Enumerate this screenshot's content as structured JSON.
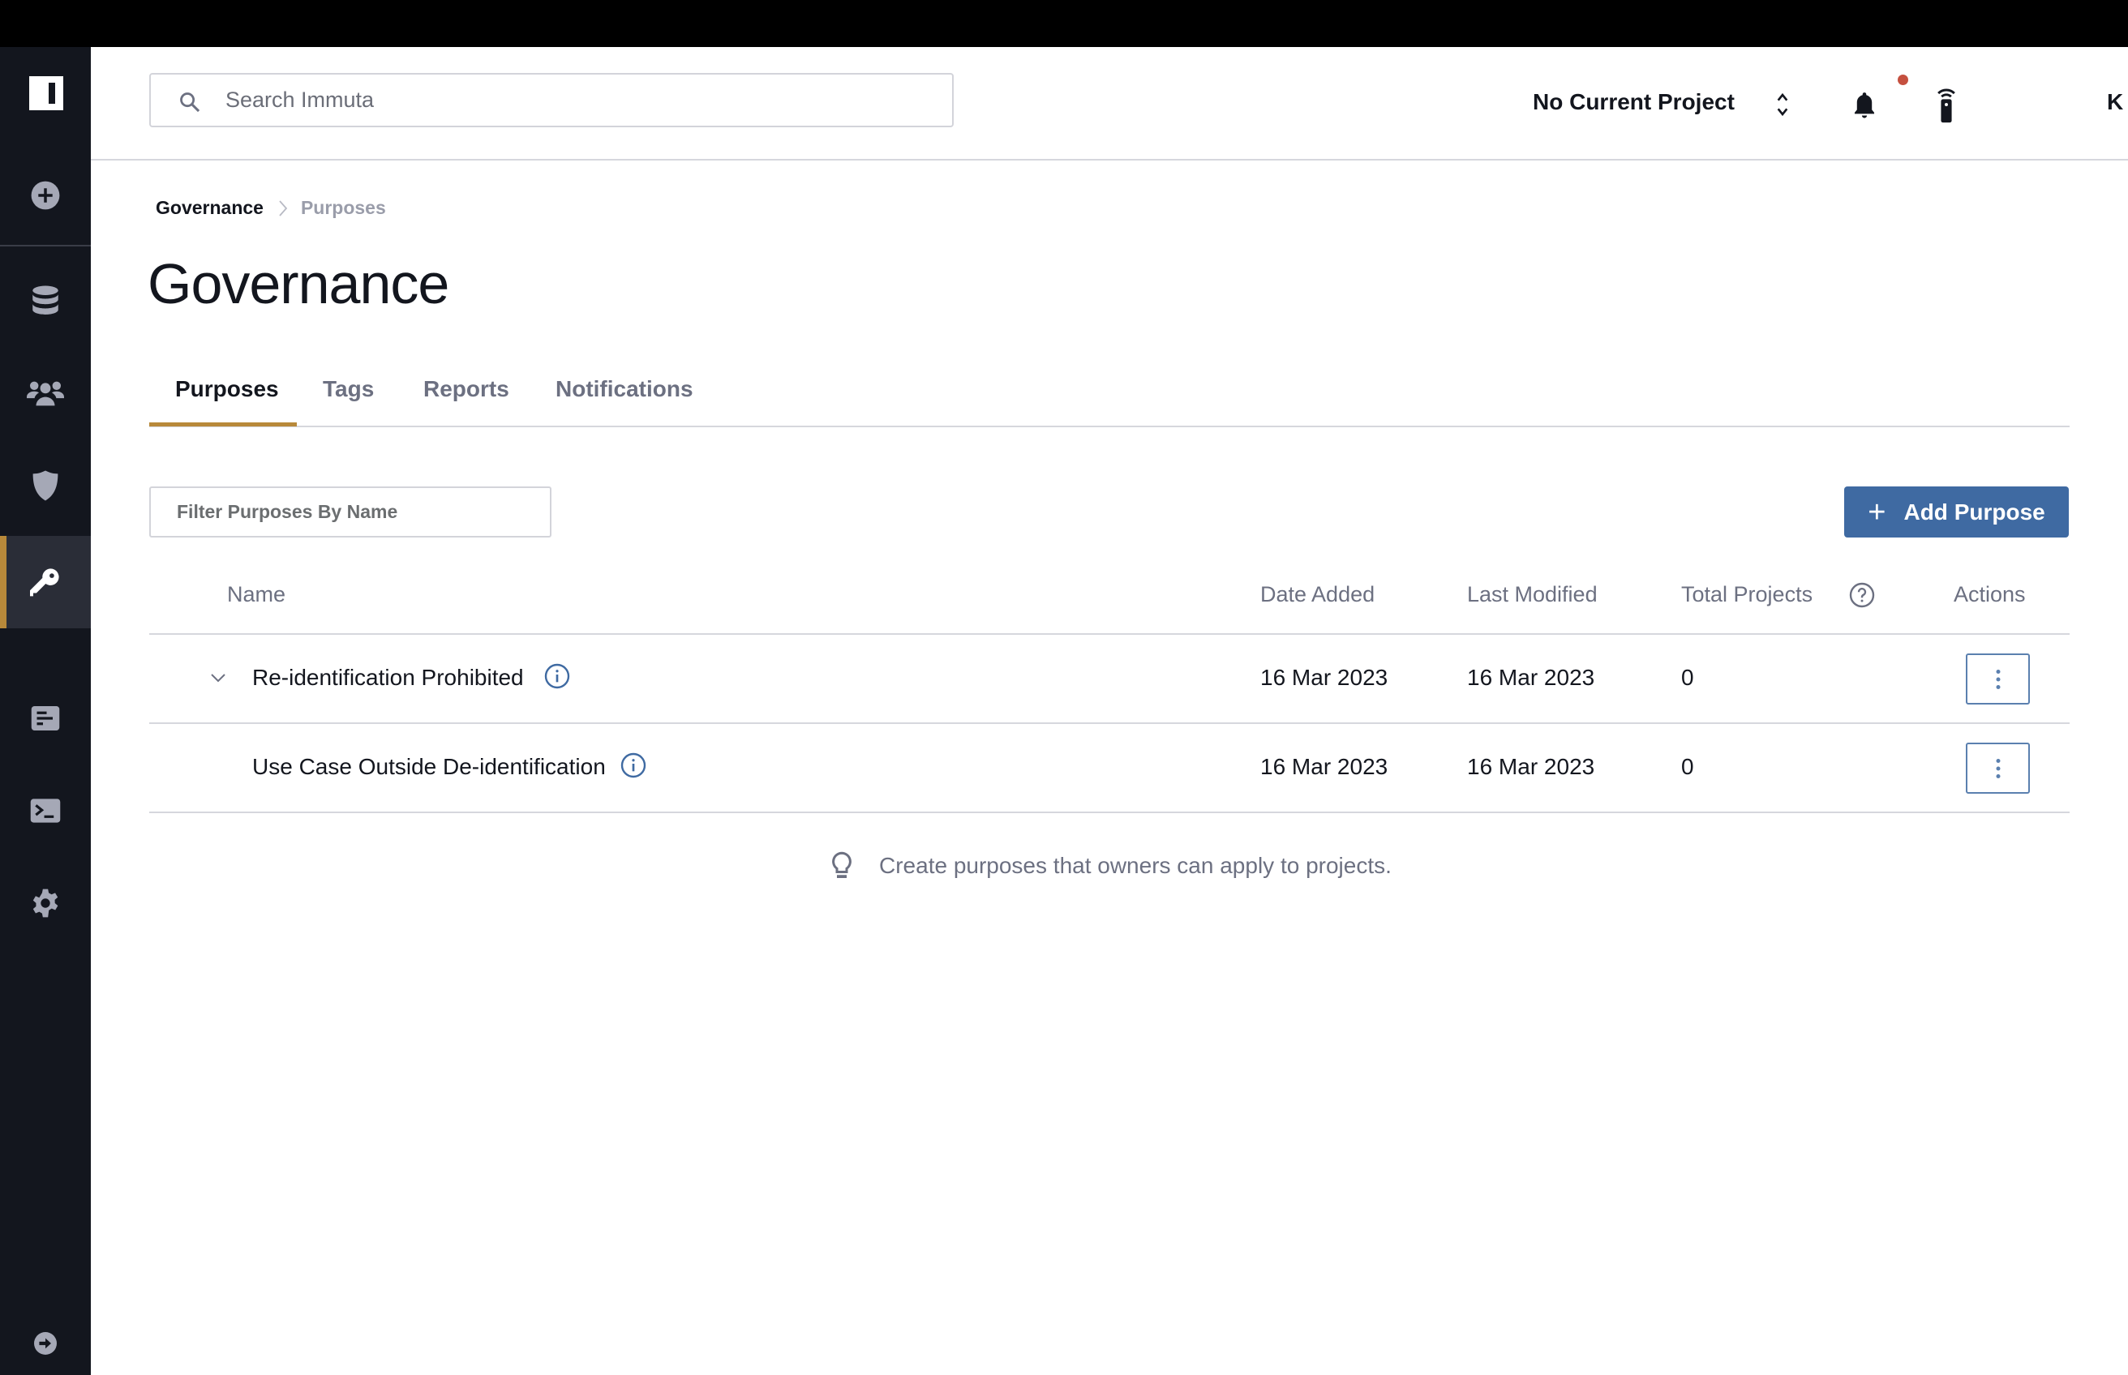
{
  "sidebar": {
    "logo": "Immuta",
    "items": [
      {
        "name": "new",
        "icon": "plus-circle-icon"
      },
      {
        "name": "data",
        "icon": "database-icon"
      },
      {
        "name": "people",
        "icon": "users-icon"
      },
      {
        "name": "policies",
        "icon": "shield-icon"
      },
      {
        "name": "governance",
        "icon": "key-icon",
        "active": true
      },
      {
        "name": "audit",
        "icon": "report-icon"
      },
      {
        "name": "query-editor",
        "icon": "terminal-icon"
      },
      {
        "name": "app-settings",
        "icon": "gear-icon"
      }
    ],
    "footer_icon": "expand-arrow-icon"
  },
  "header": {
    "search_placeholder": "Search Immuta",
    "project_label": "No Current Project",
    "avatar_initial": "K",
    "notification_dot_color": "#c5503f"
  },
  "breadcrumb": {
    "parent": "Governance",
    "current": "Purposes"
  },
  "page": {
    "title": "Governance"
  },
  "tabs": [
    {
      "label": "Purposes",
      "active": true
    },
    {
      "label": "Tags",
      "active": false
    },
    {
      "label": "Reports",
      "active": false
    },
    {
      "label": "Notifications",
      "active": false
    }
  ],
  "toolbar": {
    "filter_placeholder": "Filter Purposes By Name",
    "add_button_label": "Add Purpose",
    "accent_color": "#3f6aa2"
  },
  "table": {
    "columns": [
      "Name",
      "Date Added",
      "Last Modified",
      "Total Projects",
      "Actions"
    ],
    "rows": [
      {
        "name": "Re-identification Prohibited",
        "date_added": "16 Mar 2023",
        "last_modified": "16 Mar 2023",
        "total_projects": "0",
        "expandable": true
      },
      {
        "name": "Use Case Outside De-identification",
        "date_added": "16 Mar 2023",
        "last_modified": "16 Mar 2023",
        "total_projects": "0",
        "expandable": false
      }
    ]
  },
  "hint": {
    "text": "Create purposes that owners can apply to projects."
  }
}
